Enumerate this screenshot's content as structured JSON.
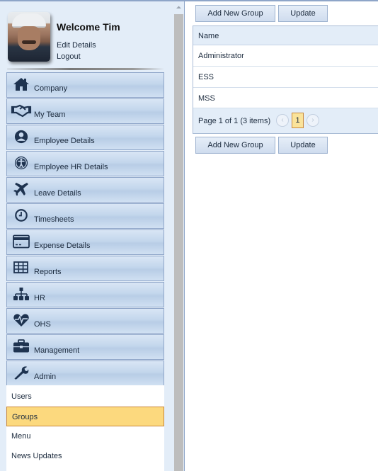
{
  "profile": {
    "welcome": "Welcome Tim",
    "edit_details": "Edit Details",
    "logout": "Logout"
  },
  "nav": {
    "items": [
      {
        "label": "Company",
        "icon": "home-icon"
      },
      {
        "label": "My Team",
        "icon": "handshake-icon"
      },
      {
        "label": "Employee Details",
        "icon": "user-icon"
      },
      {
        "label": "Employee HR Details",
        "icon": "accessibility-icon"
      },
      {
        "label": "Leave Details",
        "icon": "plane-icon"
      },
      {
        "label": "Timesheets",
        "icon": "clock-icon"
      },
      {
        "label": "Expense Details",
        "icon": "credit-card-icon"
      },
      {
        "label": "Reports",
        "icon": "table-icon"
      },
      {
        "label": "HR",
        "icon": "org-chart-icon"
      },
      {
        "label": "OHS",
        "icon": "heartbeat-icon"
      },
      {
        "label": "Management",
        "icon": "briefcase-icon"
      },
      {
        "label": "Admin",
        "icon": "wrench-icon"
      }
    ],
    "admin_submenu": [
      {
        "label": "Users",
        "selected": false
      },
      {
        "label": "Groups",
        "selected": true
      },
      {
        "label": "Menu",
        "selected": false
      },
      {
        "label": "News Updates",
        "selected": false
      }
    ]
  },
  "toolbar": {
    "add_new_group": "Add New Group",
    "update": "Update"
  },
  "grid": {
    "column_header": "Name",
    "rows": [
      "Administrator",
      "ESS",
      "MSS"
    ],
    "pager": {
      "info": "Page 1 of 1 (3 items)",
      "current_page": "1",
      "prev": "‹",
      "next": "›"
    }
  },
  "colors": {
    "selected_bg": "#fcd97e",
    "nav_border": "#8ea5c8",
    "sidebar_bg": "#e3edf8",
    "icon_color": "#1e3350"
  }
}
